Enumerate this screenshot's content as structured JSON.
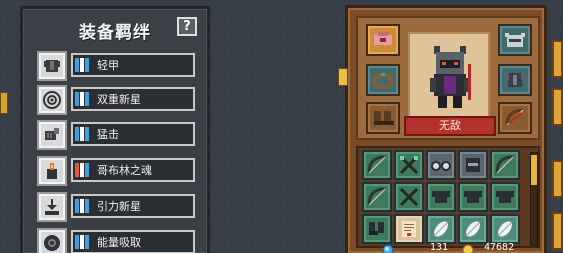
{
  "bonds_panel": {
    "title": "装备羁绊",
    "help_label": "?",
    "items": [
      {
        "name": "轻甲",
        "icon": "armor-icon",
        "pips": [
          "#3fa0e0",
          "#ffffff",
          "#3fa0e0"
        ]
      },
      {
        "name": "双重新星",
        "icon": "target-icon",
        "pips": [
          "#3fa0e0",
          "#ffffff",
          "#3fa0e0"
        ]
      },
      {
        "name": "猛击",
        "icon": "fist-icon",
        "pips": [
          "#3fa0e0",
          "#ffffff",
          "#3fa0e0"
        ]
      },
      {
        "name": "哥布林之魂",
        "icon": "goblin-soul-icon",
        "pips": [
          "#e05a3a",
          "#ffffff",
          "#3fa0e0"
        ]
      },
      {
        "name": "引力新星",
        "icon": "gravity-icon",
        "pips": [
          "#3fa0e0",
          "#ffffff",
          "#3fa0e0"
        ]
      },
      {
        "name": "能量吸取",
        "icon": "energy-drain-icon",
        "pips": [
          "#3fa0e0",
          "#ffffff",
          "#3fa0e0"
        ]
      }
    ]
  },
  "hero_panel": {
    "hero_name": "无敌",
    "equipment_slots": [
      {
        "slot": "head-left",
        "icon": "pink-amulet-icon"
      },
      {
        "slot": "head-right",
        "icon": "helmet-icon"
      },
      {
        "slot": "neck-left",
        "icon": "ring-icon"
      },
      {
        "slot": "body-right",
        "icon": "chest-armor-icon"
      },
      {
        "slot": "foot-left",
        "icon": "boots-icon"
      },
      {
        "slot": "weapon-right",
        "icon": "bow-icon"
      }
    ],
    "bag_rows": [
      [
        "bow-icon",
        "crossed-swords-icon",
        "goggles-icon",
        "helmet-icon",
        "bow-icon"
      ],
      [
        "bow-icon",
        "crossed-swords-icon",
        "chest-armor-icon",
        "chest-armor-icon",
        "chest-armor-icon"
      ],
      [
        "boots-icon",
        "scroll-icon",
        "feather-icon",
        "feather-icon",
        "feather-icon"
      ]
    ],
    "gems": "131",
    "coins": "47682"
  },
  "colors": {
    "accent_gold": "#e7b63b",
    "name_banner_red": "#b2312c"
  }
}
